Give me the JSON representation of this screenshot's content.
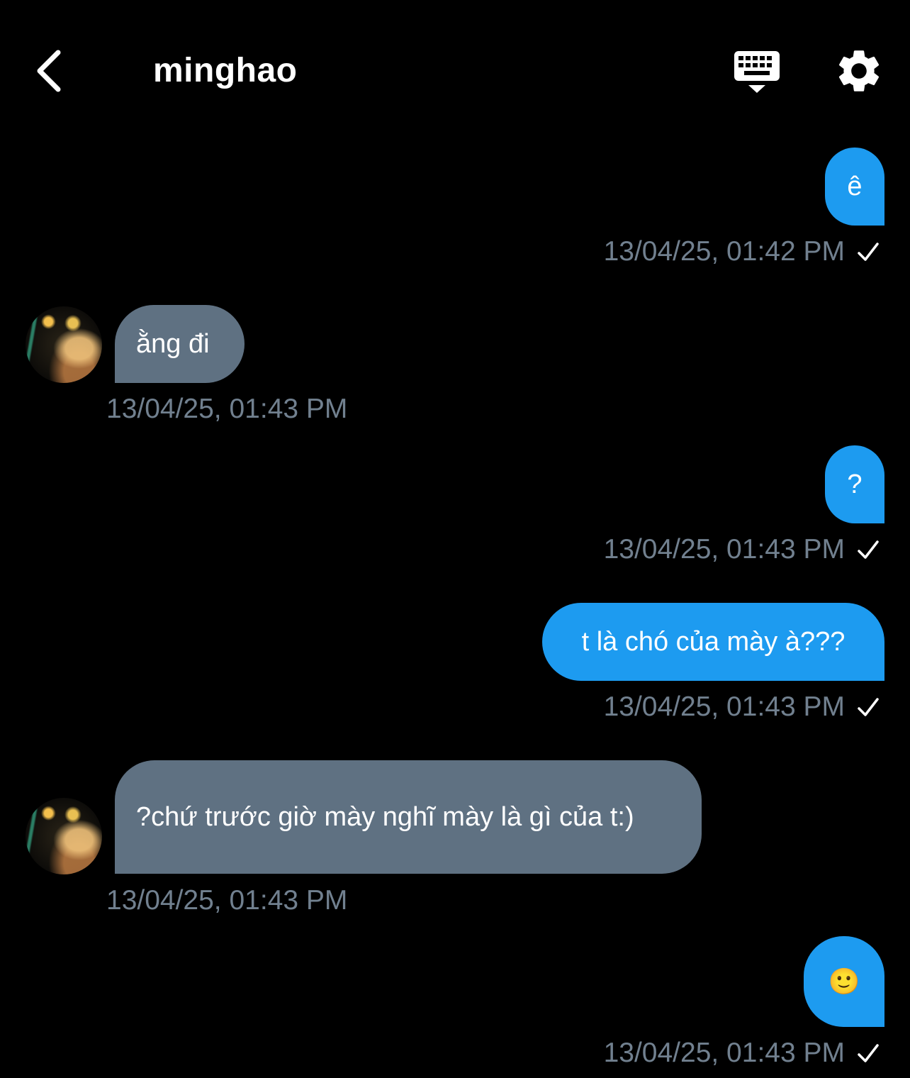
{
  "header": {
    "title": "minghao"
  },
  "messages": [
    {
      "direction": "outgoing",
      "text": "ê",
      "timestamp": "13/04/25, 01:42 PM",
      "status": "sent"
    },
    {
      "direction": "incoming",
      "text": "ằng đi",
      "timestamp": "13/04/25, 01:43 PM"
    },
    {
      "direction": "outgoing",
      "text": "?",
      "timestamp": "13/04/25, 01:43 PM",
      "status": "sent"
    },
    {
      "direction": "outgoing",
      "text": "t là chó của mày à???",
      "timestamp": "13/04/25, 01:43 PM",
      "status": "sent"
    },
    {
      "direction": "incoming",
      "text": "?chứ trước giờ mày nghĩ mày là gì của t:)",
      "timestamp": "13/04/25, 01:43 PM"
    },
    {
      "direction": "outgoing",
      "text": "🙂",
      "timestamp": "13/04/25, 01:43 PM",
      "status": "sent"
    }
  ],
  "colors": {
    "background": "#000000",
    "outgoing_bubble": "#1d9bf0",
    "incoming_bubble": "#5f7182",
    "timestamp": "#71808f"
  },
  "icons": {
    "back": "chevron-left-icon",
    "keyboard": "keyboard-icon",
    "settings": "gear-icon",
    "check": "check-icon",
    "emoji": "slightly-smiling-face-icon"
  }
}
